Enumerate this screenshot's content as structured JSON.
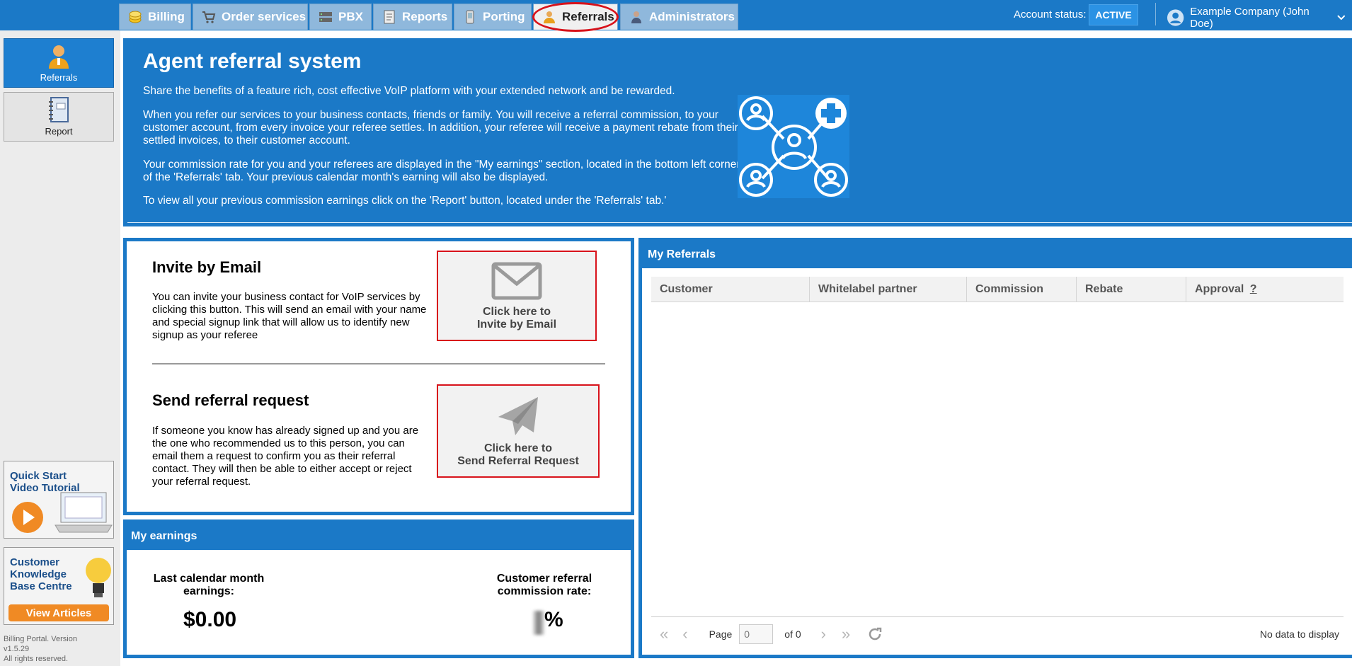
{
  "tabs": [
    {
      "label": "Billing",
      "icon": "coins-icon"
    },
    {
      "label": "Order services",
      "icon": "cart-icon"
    },
    {
      "label": "PBX",
      "icon": "server-icon"
    },
    {
      "label": "Reports",
      "icon": "report-icon"
    },
    {
      "label": "Porting",
      "icon": "phone-icon"
    },
    {
      "label": "Referrals",
      "icon": "agent-icon",
      "active": true
    },
    {
      "label": "Administrators",
      "icon": "admin-icon"
    }
  ],
  "account": {
    "status_label": "Account status:",
    "status_value": "ACTIVE"
  },
  "user": {
    "name": "Example Company (John Doe)"
  },
  "sidebar": {
    "items": [
      {
        "label": "Referrals",
        "active": true
      },
      {
        "label": "Report",
        "active": false
      }
    ],
    "promos": [
      {
        "title": "Quick Start Video Tutorial"
      },
      {
        "title": "Customer Knowledge Base Centre",
        "button": "View Articles"
      }
    ],
    "footer": [
      "Billing Portal. Version",
      "v1.5.29",
      "All rights reserved."
    ]
  },
  "hero": {
    "title": "Agent referral system",
    "paragraphs": [
      "Share the benefits of a feature rich, cost effective VoIP platform with your extended network and be rewarded.",
      "When you refer our services to your business contacts, friends or family. You will receive a referral commission, to your customer account, from every invoice your referee settles. In addition, your referee will receive a payment rebate from their settled invoices, to their customer account.",
      "Your commission rate for you and your referees are displayed in the \"My earnings\" section, located in the bottom left corner of the 'Referrals' tab. Your previous calendar month's earning will also be displayed.",
      "To view all your previous commission earnings click on the 'Report' button, located under the 'Referrals' tab.'"
    ]
  },
  "invite": {
    "email_title": "Invite by Email",
    "email_desc": "You can invite your business contact for VoIP services by clicking this button. This will send an email with your name and special signup link that will allow us to identify new signup as your referee",
    "email_button_line1": "Click here to",
    "email_button_line2": "Invite by Email",
    "request_title": "Send referral request",
    "request_desc": "If someone you know has already signed up and you are the one who recommended us to this person, you can email them a request to confirm you as their referral contact. They will then be able to either accept or reject your referral request.",
    "request_button_line1": "Click here to",
    "request_button_line2": "Send Referral Request"
  },
  "earnings": {
    "title": "My earnings",
    "last_month_label": "Last calendar month earnings:",
    "last_month_value": "$0.00",
    "rate_label": "Customer referral commission rate:",
    "rate_suffix": "%"
  },
  "referrals": {
    "title": "My Referrals",
    "columns": [
      "Customer",
      "Whitelabel partner",
      "Commission",
      "Rebate",
      "Approval"
    ],
    "approval_help": "?",
    "pager": {
      "page_label": "Page",
      "page_value": "0",
      "of_label": "of 0",
      "empty_text": "No data to display"
    }
  },
  "colors": {
    "brand_blue": "#1b79c7",
    "highlight_red": "#d8131b"
  }
}
